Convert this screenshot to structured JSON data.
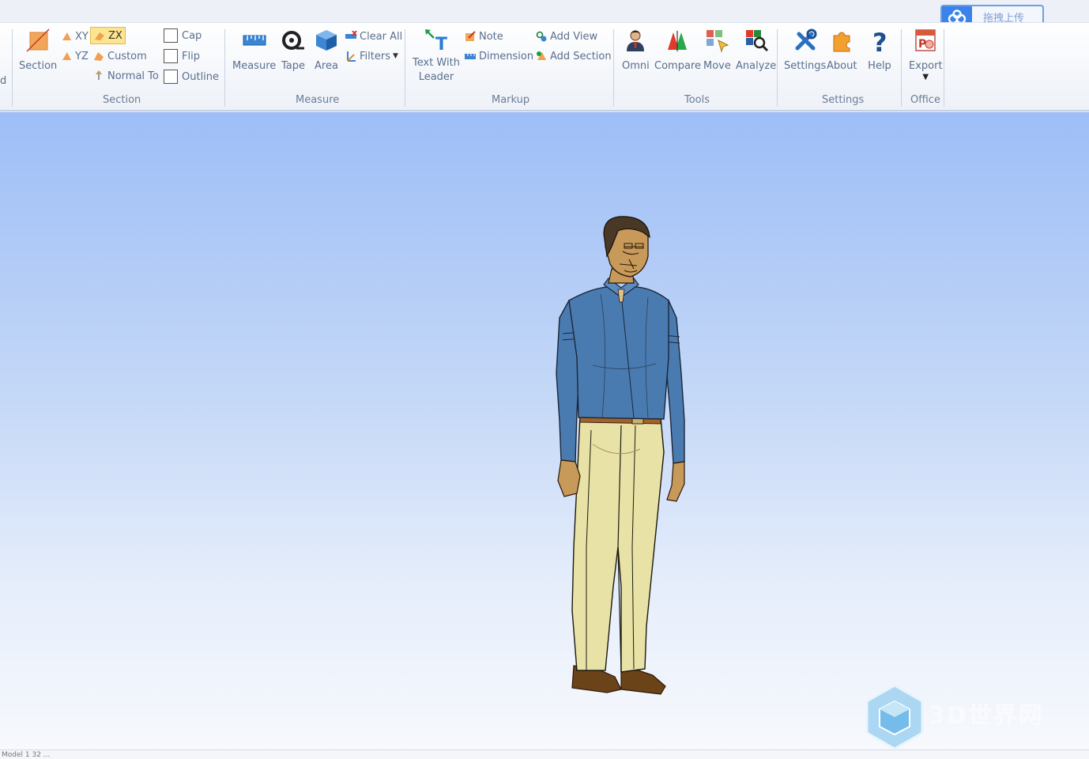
{
  "ribbon": {
    "cut_label": "d",
    "section": {
      "big_button": "Section",
      "planes": {
        "xy": "XY",
        "zx": "ZX",
        "yz": "YZ",
        "custom": "Custom",
        "normal_to": "Normal To"
      },
      "options": {
        "cap": "Cap",
        "flip": "Flip",
        "outline": "Outline"
      },
      "group_label": "Section"
    },
    "measure": {
      "measure": "Measure",
      "tape": "Tape",
      "area": "Area",
      "clear_all": "Clear All",
      "filters": "Filters",
      "group_label": "Measure"
    },
    "markup": {
      "text_with_leader_line1": "Text With",
      "text_with_leader_line2": "Leader",
      "note": "Note",
      "dimension": "Dimension",
      "add_view": "Add View",
      "add_section": "Add Section",
      "group_label": "Markup"
    },
    "tools": {
      "omni": "Omni",
      "compare": "Compare",
      "move": "Move",
      "analyze": "Analyze",
      "group_label": "Tools"
    },
    "settings": {
      "settings": "Settings",
      "about": "About",
      "help": "Help",
      "group_label": "Settings"
    },
    "office": {
      "export": "Export",
      "group_label": "Office"
    }
  },
  "upload_widget": {
    "label": "拖拽上传"
  },
  "viewport": {
    "model": "human-figure"
  },
  "watermark": {
    "text": "3D世界网"
  },
  "statusbar": {
    "text": "Model 1 32 ... "
  },
  "colors": {
    "shirt": "#4a7bb0",
    "pants": "#e9e2a6",
    "shoes": "#6b4318",
    "hair": "#4a3826",
    "background_top": "#9dbef7",
    "background_bottom": "#f7f9fd",
    "accent_zx": "#fde58f"
  }
}
